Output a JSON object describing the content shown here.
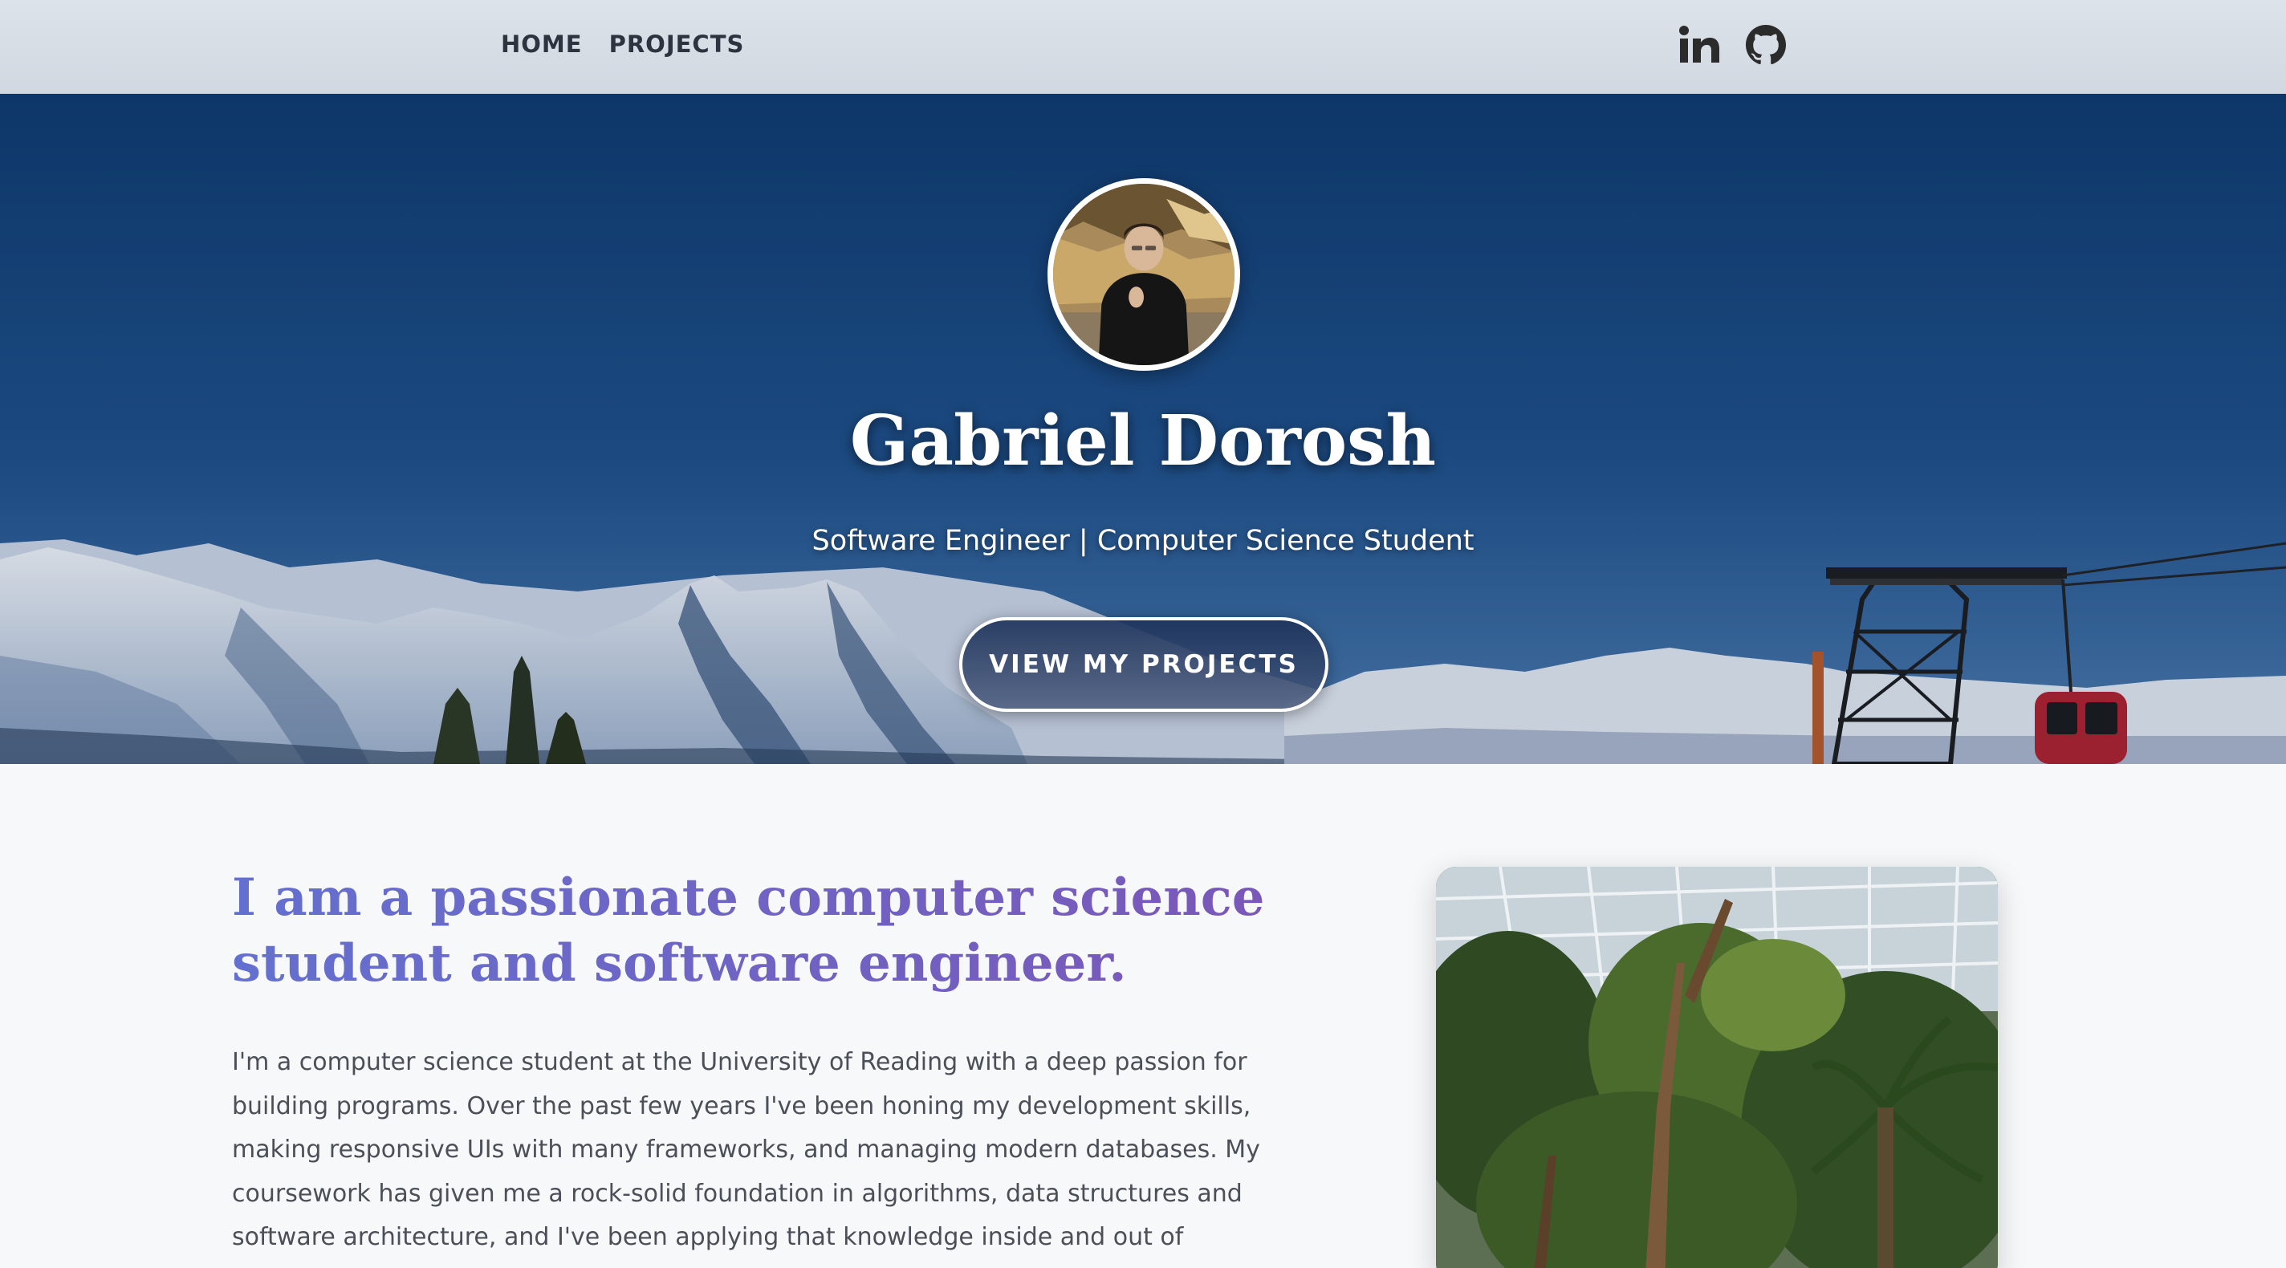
{
  "nav": {
    "links": [
      "HOME",
      "PROJECTS"
    ],
    "social_icons": [
      "linkedin-icon",
      "github-icon"
    ]
  },
  "hero": {
    "name": "Gabriel Dorosh",
    "tagline": "Software Engineer | Computer Science Student",
    "cta_label": "VIEW MY PROJECTS"
  },
  "about": {
    "heading": "I am a passionate computer science student and software engineer.",
    "body": "I'm a computer science student at the University of Reading with a deep passion for building programs. Over the past few years I've been honing my development skills, making responsive UIs with many frameworks, and managing modern databases. My coursework has given me a rock-solid foundation in algorithms, data structures and software architecture, and I've been applying that knowledge inside and out of several"
  },
  "colors": {
    "nav_bg": "#d1d8e1",
    "hero_sky": "#1a4a82",
    "heading_gradient_start": "#6470cf",
    "heading_gradient_end": "#7a57b8",
    "body_text": "#4a4f58"
  }
}
